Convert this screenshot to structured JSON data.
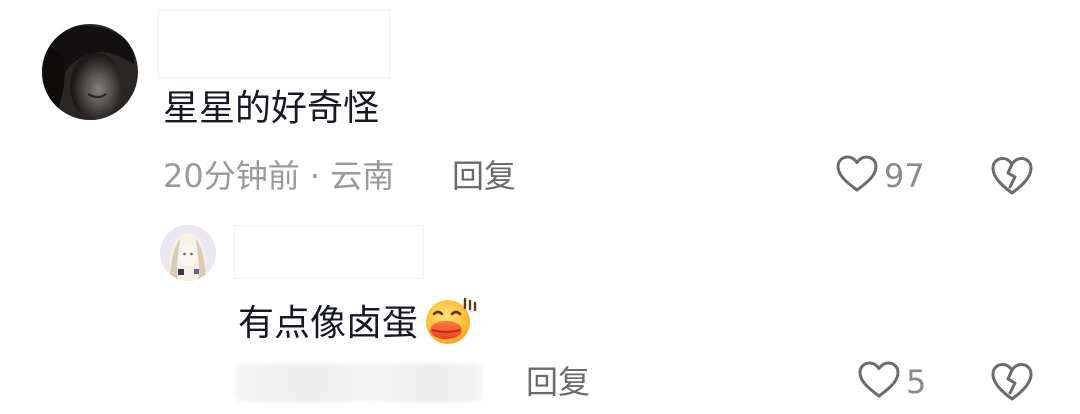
{
  "comment": {
    "text": "星星的好奇怪",
    "meta": "20分钟前 · 云南",
    "reply_label": "回复",
    "like_count": "97"
  },
  "reply": {
    "text": "有点像卤蛋",
    "emoji": "duck-face-emoji",
    "reply_label": "回复",
    "like_count": "5"
  },
  "icons": {
    "like": "heart-outline-icon",
    "dislike": "broken-heart-icon"
  },
  "colors": {
    "text_primary": "#161823",
    "text_secondary": "#9a9a9a",
    "icon_gray": "#6b6b6b"
  }
}
